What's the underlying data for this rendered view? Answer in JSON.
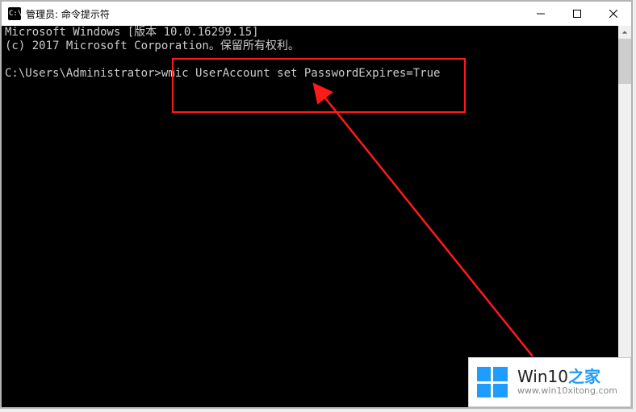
{
  "window": {
    "title": "管理员: 命令提示符"
  },
  "console": {
    "line1": "Microsoft Windows [版本 10.0.16299.15]",
    "line2": "(c) 2017 Microsoft Corporation。保留所有权利。",
    "prompt": "C:\\Users\\Administrator>",
    "command": "wmic UserAccount set PasswordExpires=True"
  },
  "annotation": {
    "highlight_color": "#ff1a1a"
  },
  "watermark": {
    "brand_prefix": "Win10",
    "brand_suffix": "之家",
    "url": "www.win10xitong.com"
  }
}
